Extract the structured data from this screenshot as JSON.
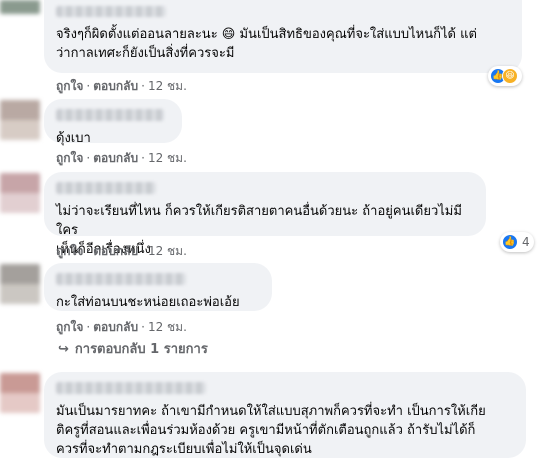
{
  "comments": [
    {
      "text": "จริงๆก็ผิดตั้งแต่ออนลายละนะ 😄 มันเป็นสิทธิของคุณที่จะใส่แบบไหนก็ได้ แต่\nว่ากาลเทศะก็ยังเป็นสิ่งที่ควรจะมี",
      "like_label": "ถูกใจ",
      "reply_label": "ตอบกลับ",
      "time": "12 ชม.",
      "reaction_count": "",
      "reactions": [
        "like-icon",
        "haha-icon"
      ]
    },
    {
      "text": "ดุ้งเบา",
      "like_label": "ถูกใจ",
      "reply_label": "ตอบกลับ",
      "time": "12 ชม."
    },
    {
      "text": "ไม่ว่าจะเรียนที่ไหน ก็ควรให้เกียรติสายตาคนอื่นด้วยนะ ถ้าอยู่คนเดียวไม่มีใคร\nเห็นก็อีกเรื่องหนึ่ง",
      "like_label": "ถูกใจ",
      "reply_label": "ตอบกลับ",
      "time": "12 ชม.",
      "reaction_count": "4",
      "reactions": [
        "like-icon"
      ]
    },
    {
      "text": "กะใส่ท่อนบนชะหน่อยเถอะพ่อเอ้ย",
      "like_label": "ถูกใจ",
      "reply_label": "ตอบกลับ",
      "time": "12 ชม.",
      "replies_label": "การตอบกลับ 1 รายการ"
    },
    {
      "text": "มันเป็นมารยาทคะ ถ้าเขามีกำหนดให้ใส่แบบสุภาพก็ควรที่จะทำ เป็นการให้เกีย\nติครูที่สอนและเพื่อนร่วมห้องด้วย ครูเขามีหน้าที่ตักเตือนถูกแล้ว ถ้ารับไม่ได้ก็\nควรที่จะทำตามกฎระเบียบเพื่อไม่ให้เป็นจุดเด่น"
    }
  ],
  "colors": {
    "bubble": "#f0f2f5",
    "secondary_text": "#65676b",
    "like_blue": "#1877f2",
    "haha_yellow": "#f7b125"
  }
}
